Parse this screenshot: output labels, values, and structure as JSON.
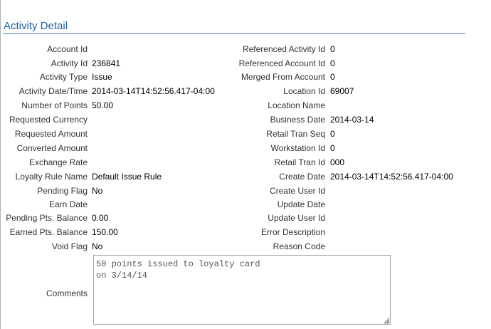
{
  "header": {
    "title": "Activity Detail"
  },
  "left_fields": [
    {
      "label": "Account Id",
      "value": ""
    },
    {
      "label": "Activity Id",
      "value": "236841"
    },
    {
      "label": "Activity Type",
      "value": "Issue"
    },
    {
      "label": "Activity Date/Time",
      "value": "2014-03-14T14:52:56.417-04:00"
    },
    {
      "label": "Number of Points",
      "value": "50.00"
    },
    {
      "label": "Requested Currency",
      "value": ""
    },
    {
      "label": "Requested Amount",
      "value": ""
    },
    {
      "label": "Converted Amount",
      "value": ""
    },
    {
      "label": "Exchange Rate",
      "value": ""
    },
    {
      "label": "Loyalty Rule Name",
      "value": "Default Issue Rule"
    },
    {
      "label": "Pending Flag",
      "value": "No"
    },
    {
      "label": "Earn Date",
      "value": ""
    },
    {
      "label": "Pending Pts. Balance",
      "value": "0.00"
    },
    {
      "label": "Earned Pts. Balance",
      "value": "150.00"
    },
    {
      "label": "Void Flag",
      "value": "No"
    }
  ],
  "right_fields": [
    {
      "label": "Referenced Activity Id",
      "value": "0"
    },
    {
      "label": "Referenced Account Id",
      "value": "0"
    },
    {
      "label": "Merged From Account",
      "value": "0"
    },
    {
      "label": "Location Id",
      "value": "69007"
    },
    {
      "label": "Location Name",
      "value": ""
    },
    {
      "label": "Business Date",
      "value": "2014-03-14"
    },
    {
      "label": "Retail Tran Seq",
      "value": "0"
    },
    {
      "label": "Workstation Id",
      "value": "0"
    },
    {
      "label": "Retail Tran Id",
      "value": "000"
    },
    {
      "label": "Create Date",
      "value": "2014-03-14T14:52:56.417-04:00"
    },
    {
      "label": "Create User Id",
      "value": ""
    },
    {
      "label": "Update Date",
      "value": ""
    },
    {
      "label": "Update User Id",
      "value": ""
    },
    {
      "label": "Error Description",
      "value": ""
    },
    {
      "label": "Reason Code",
      "value": ""
    }
  ],
  "comments": {
    "label": "Comments",
    "value": "50 points issued to loyalty card\non 3/14/14"
  }
}
